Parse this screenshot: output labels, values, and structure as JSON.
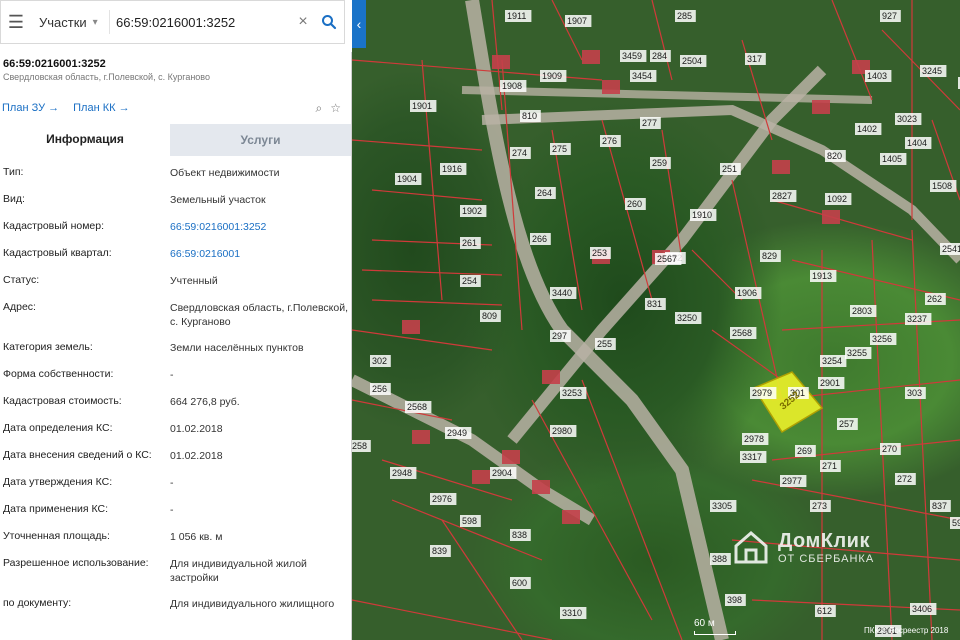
{
  "search": {
    "section_label": "Участки",
    "query": "66:59:0216001:3252"
  },
  "panel": {
    "cadastral_number": "66:59:0216001:3252",
    "address_short": "Свердловская область, г.Полевской, с. Курганово",
    "link_plan_zu": "План ЗУ →",
    "link_plan_kk": "План КК →",
    "tab_info": "Информация",
    "tab_services": "Услуги",
    "rows": [
      {
        "k": "Тип:",
        "v": "Объект недвижимости"
      },
      {
        "k": "Вид:",
        "v": "Земельный участок"
      },
      {
        "k": "Кадастровый номер:",
        "v": "66:59:0216001:3252"
      },
      {
        "k": "Кадастровый квартал:",
        "v": "66:59:0216001"
      },
      {
        "k": "Статус:",
        "v": "Учтенный"
      },
      {
        "k": "Адрес:",
        "v": "Свердловская область, г.Полевской, с. Курганово"
      },
      {
        "k": "Категория земель:",
        "v": "Земли населённых пунктов"
      },
      {
        "k": "Форма собственности:",
        "v": "-"
      },
      {
        "k": "Кадастровая стоимость:",
        "v": "664 276,8 руб."
      },
      {
        "k": "Дата определения КС:",
        "v": "01.02.2018"
      },
      {
        "k": "Дата внесения сведений о КС:",
        "v": "01.02.2018"
      },
      {
        "k": "Дата утверждения КС:",
        "v": "-"
      },
      {
        "k": "Дата применения КС:",
        "v": "-"
      },
      {
        "k": "Уточненная площадь:",
        "v": "1 056 кв. м"
      },
      {
        "k": "Разрешенное использование:",
        "v": "Для индивидуальной жилой застройки"
      },
      {
        "k": "по документу:",
        "v": "Для индивидуального жилищного"
      }
    ]
  },
  "map": {
    "highlight_label": "3252",
    "parcel_labels": [
      "1911",
      "1907",
      "285",
      "927",
      "3459",
      "284",
      "2504",
      "317",
      "1403",
      "3245",
      "3335",
      "1908",
      "1909",
      "1901",
      "3454",
      "810",
      "1402",
      "3023",
      "277",
      "274",
      "275",
      "276",
      "1404",
      "820",
      "1405",
      "1904",
      "1916",
      "259",
      "251",
      "1508",
      "264",
      "260",
      "2827",
      "1092",
      "1902",
      "1910",
      "266",
      "252",
      "829",
      "2541",
      "261",
      "253",
      "2567",
      "1913",
      "262",
      "254",
      "3440",
      "831",
      "3250",
      "1906",
      "2803",
      "3237",
      "2568",
      "809",
      "297",
      "255",
      "3256",
      "3254",
      "3255",
      "2901",
      "303",
      "302",
      "256",
      "2568",
      "3253",
      "2979",
      "301",
      "257",
      "2949",
      "2980",
      "2978",
      "269",
      "270",
      "258",
      "2948",
      "2904",
      "3317",
      "271",
      "272",
      "2976",
      "598",
      "2977",
      "3305",
      "273",
      "837",
      "838",
      "596",
      "839",
      "600",
      "388",
      "3310",
      "398",
      "612",
      "3406",
      "2901",
      "3252"
    ],
    "scale_label": "60 м",
    "copyright": "ПКК © Росреестр 2018"
  },
  "watermark": {
    "line1": "ДомКлик",
    "line2": "ОТ СБЕРБАНКА"
  }
}
